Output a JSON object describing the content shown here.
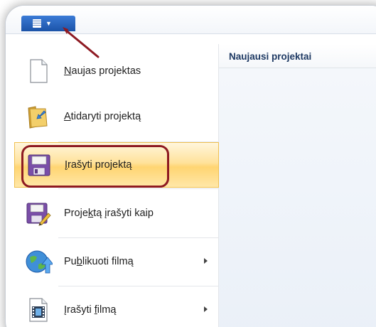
{
  "app_menu": {
    "icon": "document-list-icon"
  },
  "menu": {
    "items": [
      {
        "label": "Naujas projektas",
        "accel_index": 0,
        "icon": "new-document-icon",
        "has_submenu": false
      },
      {
        "label": "Atidaryti projektą",
        "accel_index": 0,
        "icon": "open-folder-icon",
        "has_submenu": false
      },
      {
        "label": "Įrašyti projektą",
        "accel_index": 0,
        "icon": "save-floppy-icon",
        "has_submenu": false,
        "highlighted": true
      },
      {
        "label": "Projektą įrašyti kaip",
        "accel_index": 5,
        "icon": "save-as-icon",
        "has_submenu": false
      },
      {
        "label": "Publikuoti filmą",
        "accel_index": 2,
        "icon": "publish-globe-icon",
        "has_submenu": true
      },
      {
        "label": "Įrašyti filmą",
        "accel_index": 8,
        "icon": "save-movie-icon",
        "has_submenu": true
      }
    ]
  },
  "recent": {
    "header": "Naujausi projektai"
  },
  "colors": {
    "accent": "#1b53a8",
    "highlight": "#ffd572",
    "annotation": "#8e1a22"
  }
}
